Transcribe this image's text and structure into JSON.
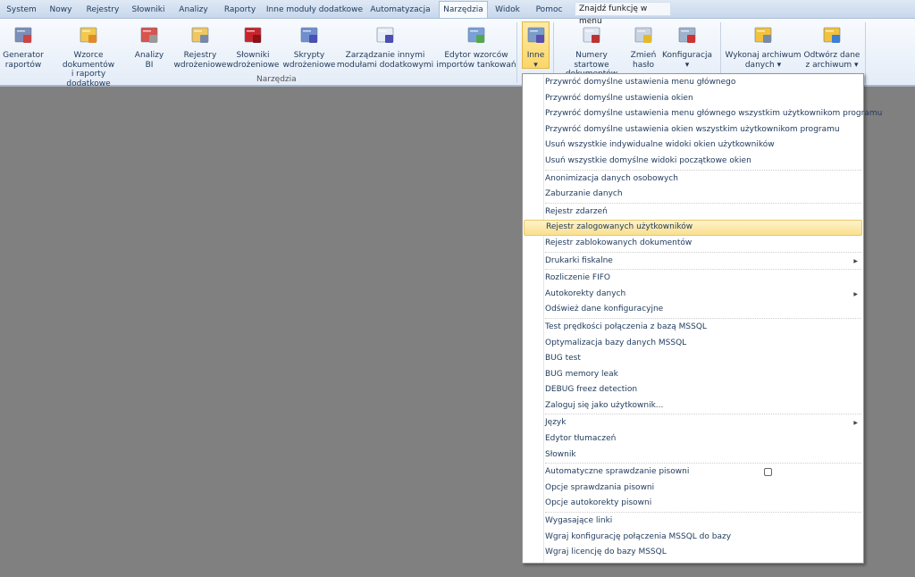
{
  "tabs": [
    "System",
    "Nowy",
    "Rejestry",
    "Słowniki",
    "Analizy",
    "Raporty",
    "Inne moduły dodatkowe",
    "Automatyzacja",
    "Narzędzia",
    "Widok",
    "Pomoc"
  ],
  "active_tab": "Narzędzia",
  "search_placeholder": "Znajdź funkcję w menu",
  "ribbon": {
    "group_label": "Narzędzia",
    "buttons": [
      {
        "l1": "Generator",
        "l2": "raportów"
      },
      {
        "l1": "Wzorce dokumentów",
        "l2": "i raporty dodatkowe"
      },
      {
        "l1": "Analizy",
        "l2": "BI"
      },
      {
        "l1": "Rejestry",
        "l2": "wdrożeniowe"
      },
      {
        "l1": "Słowniki",
        "l2": "wdrożeniowe"
      },
      {
        "l1": "Skrypty",
        "l2": "wdrożeniowe"
      },
      {
        "l1": "Zarządzanie innymi",
        "l2": "modułami dodatkowymi"
      },
      {
        "l1": "Edytor wzorców",
        "l2": "importów tankowań"
      },
      {
        "l1": "Inne",
        "l2": "▾"
      },
      {
        "l1": "Numery startowe",
        "l2": "dokumentów"
      },
      {
        "l1": "Zmień",
        "l2": "hasło"
      },
      {
        "l1": "Konfiguracja",
        "l2": "▾"
      },
      {
        "l1": "Wykonaj archiwum",
        "l2": "danych ▾"
      },
      {
        "l1": "Odtwórz dane",
        "l2": "z archiwum ▾"
      }
    ]
  },
  "menu": [
    "Przywróć domyślne ustawienia menu głównego",
    "Przywróć domyślne ustawienia okien",
    "Przywróć domyślne ustawienia menu głównego wszystkim użytkownikom programu",
    "Przywróć domyślne ustawienia okien wszystkim użytkownikom programu",
    "Usuń wszystkie indywidualne widoki okien użytkowników",
    "Usuń wszystkie domyślne widoki początkowe okien",
    "Anonimizacja danych osobowych",
    "Zaburzanie danych",
    "Rejestr zdarzeń",
    "Rejestr zalogowanych użytkowników",
    "Rejestr zablokowanych dokumentów",
    "Drukarki fiskalne",
    "Rozliczenie FIFO",
    "Autokorekty danych",
    "Odśwież dane konfiguracyjne",
    "Test prędkości połączenia z bazą MSSQL",
    "Optymalizacja bazy danych MSSQL",
    "BUG test",
    "BUG memory leak",
    "DEBUG freez detection",
    "Zaloguj się jako użytkownik...",
    "Język",
    "Edytor tłumaczeń",
    "Słownik",
    "Automatyczne sprawdzanie pisowni",
    "Opcje sprawdzania pisowni",
    "Opcje autokorekty pisowni",
    "Wygasające linki",
    "Wgraj konfigurację połączenia MSSQL do bazy",
    "Wgraj licencję do bazy MSSQL"
  ],
  "menu_selected_index": 9,
  "menu_submenu_indices": [
    11,
    13,
    21
  ],
  "menu_separators_before": [
    6,
    8,
    11,
    12,
    15,
    21,
    24,
    27
  ],
  "auto_spellcheck_checked": false
}
